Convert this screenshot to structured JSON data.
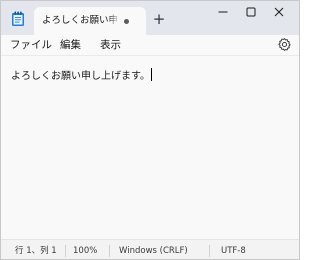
{
  "tab": {
    "title": "よろしくお願い申し上げます。",
    "new_tab_symbol": "+"
  },
  "menu": {
    "file": "ファイル",
    "edit": "編集",
    "view": "表示"
  },
  "editor": {
    "content": "よろしくお願い申し上げます。"
  },
  "status": {
    "position": "行 1、列 1",
    "zoom": "100%",
    "line_ending": "Windows (CRLF)",
    "encoding": "UTF-8"
  },
  "icons": {
    "app": "notepad-icon",
    "unsaved": "unsaved-dot-icon",
    "minimize": "minimize-icon",
    "maximize": "maximize-icon",
    "close": "close-icon",
    "settings": "gear-icon"
  }
}
